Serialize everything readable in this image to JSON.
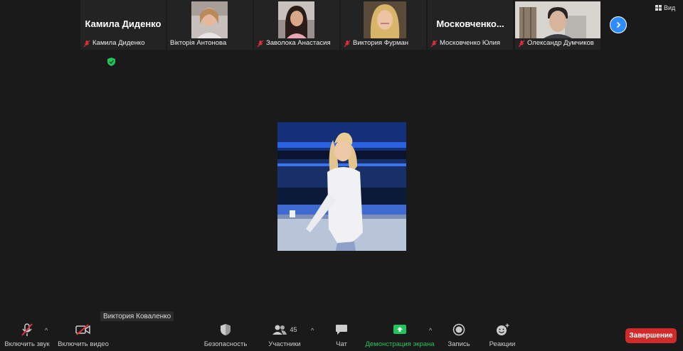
{
  "participants_strip": [
    {
      "display_name": "Камила Диденко",
      "caption": "Камила Диденко",
      "has_video": false,
      "muted": true
    },
    {
      "caption": "Вікторія Антонова",
      "has_video": true,
      "muted": false
    },
    {
      "caption": "Заволока Анастасия",
      "has_video": true,
      "muted": true
    },
    {
      "caption": "Виктория Фурман",
      "has_video": true,
      "muted": true
    },
    {
      "display_name": "Московченко...",
      "caption": "Московченко Юлия",
      "has_video": false,
      "muted": true
    },
    {
      "caption": "Олександр Думчиков",
      "has_video": true,
      "muted": true
    }
  ],
  "view_button": {
    "label": "Вид"
  },
  "active_speaker": {
    "name": "Виктория Коваленко"
  },
  "toolbar": {
    "audio_label": "Включить звук",
    "video_label": "Включить видео",
    "security_label": "Безопасность",
    "participants_label": "Участники",
    "participants_count": "45",
    "chat_label": "Чат",
    "share_label": "Демонстрация экрана",
    "record_label": "Запись",
    "reactions_label": "Реакции",
    "end_label": "Завершение"
  },
  "colors": {
    "background": "#1a1a1a",
    "accent_blue": "#2d8cff",
    "share_green": "#21c55d",
    "end_red": "#d12a2a",
    "muted_red": "#e0323c"
  }
}
